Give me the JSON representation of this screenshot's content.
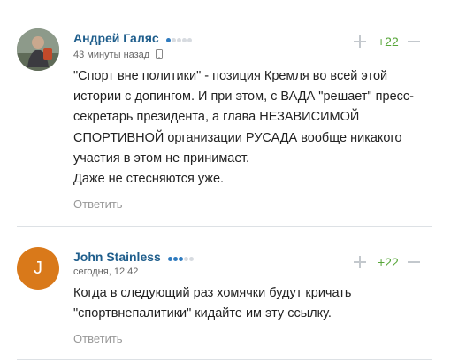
{
  "comments": [
    {
      "author": "Андрей Галяс",
      "rating_dots": {
        "filled": 1,
        "total": 5
      },
      "time": "43 минуты назад",
      "device_icon": "phone-icon",
      "text_lines": [
        "\"Спорт вне политики\" - позиция Кремля во всей этой",
        "истории с допингом. И при этом, с ВАДА \"решает\" пресс-",
        "секретарь президента, а глава НЕЗАВИСИМОЙ",
        "СПОРТИВНОЙ организации РУСАДА вообще никакого",
        "участия в этом не принимает.",
        "Даже не стесняются уже."
      ],
      "reply_label": "Ответить",
      "score": "+22",
      "avatar_type": "photo"
    },
    {
      "author": "John Stainless",
      "rating_dots": {
        "filled": 3,
        "total": 5
      },
      "time": "сегодня, 12:42",
      "avatar_letter": "J",
      "text_lines": [
        "Когда в следующий раз хомячки будут кричать",
        "\"спортвнепалитики\" кидайте им эту ссылку."
      ],
      "reply_label": "Ответить",
      "score": "+22",
      "avatar_type": "letter"
    }
  ],
  "colors": {
    "author": "#1f5e8c",
    "score_positive": "#57a639",
    "dot_on": "#2f7bbf",
    "dot_off": "#d7dbe0",
    "letter_avatar": "#d9791a"
  }
}
